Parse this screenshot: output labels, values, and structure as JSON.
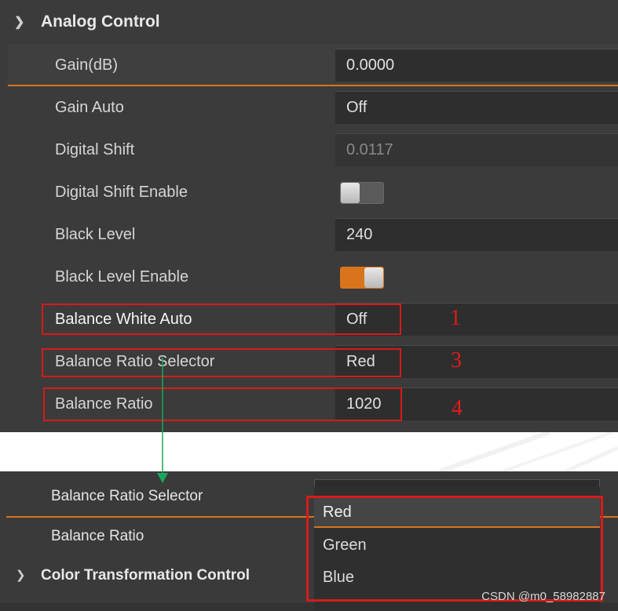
{
  "top_panel": {
    "section_title": "Analog Control",
    "rows": [
      {
        "label": "Gain(dB)",
        "value": "0.0000"
      },
      {
        "label": "Gain Auto",
        "value": "Off"
      },
      {
        "label": "Digital Shift",
        "value": "0.0117"
      },
      {
        "label": "Digital Shift Enable",
        "toggle": "off"
      },
      {
        "label": "Black Level",
        "value": "240"
      },
      {
        "label": "Black Level Enable",
        "toggle": "on"
      },
      {
        "label": "Balance White Auto",
        "value": "Off",
        "annotation": "1"
      },
      {
        "label": "Balance Ratio Selector",
        "value": "Red",
        "annotation": "3"
      },
      {
        "label": "Balance Ratio",
        "value": "1020",
        "annotation": "4"
      }
    ]
  },
  "bottom_panel": {
    "rows": [
      {
        "label": "Balance Ratio Selector"
      },
      {
        "label": "Balance Ratio"
      }
    ],
    "section_title": "Color Transformation Control",
    "dropdown_options": [
      "Red",
      "Green",
      "Blue"
    ],
    "dropdown_selected": "Red"
  },
  "colors": {
    "accent": "#d9741d",
    "annotation_red": "#d81a1a",
    "arrow_green": "#1aa85a"
  },
  "watermark": "CSDN @m0_58982887"
}
